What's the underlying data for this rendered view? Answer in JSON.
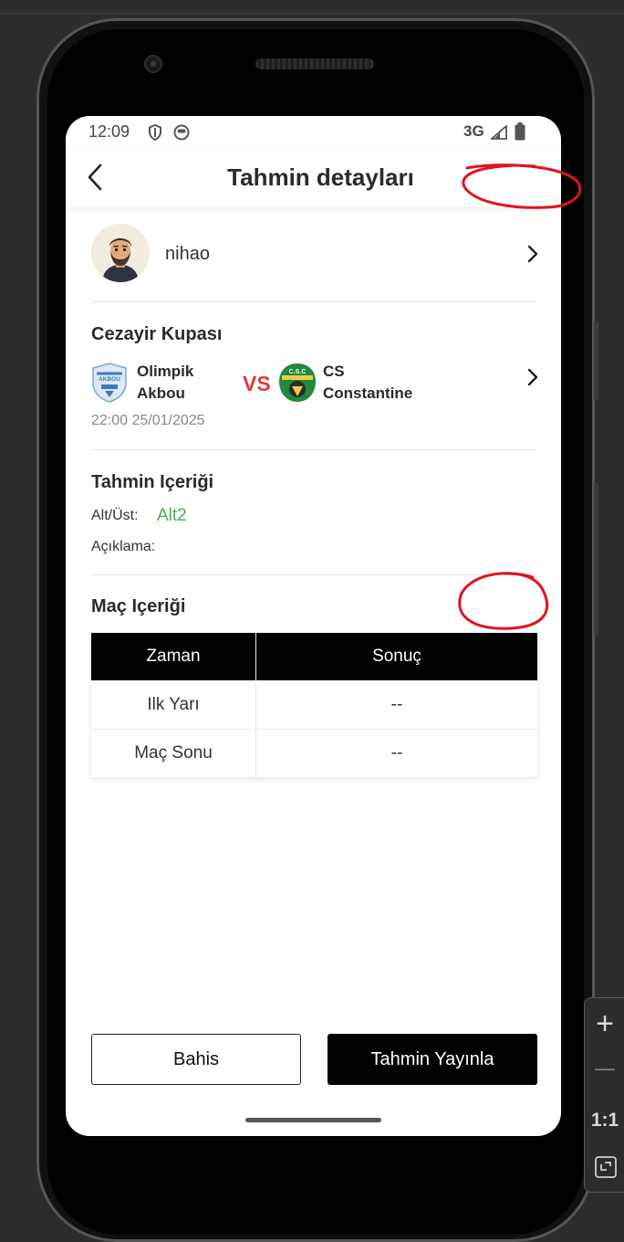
{
  "status_bar": {
    "time": "12:09",
    "network": "3G"
  },
  "header": {
    "title": "Tahmin detayları"
  },
  "user": {
    "name": "nihao"
  },
  "match": {
    "league": "Cezayir Kupası",
    "home_team": "Olimpik\nAkbou",
    "away_team": "CS\nConstantine",
    "home_logo_text": "AKBOU",
    "away_logo_text": "C.S.C",
    "vs": "VS",
    "datetime": "22:00 25/01/2025"
  },
  "prediction": {
    "section_title": "Tahmin Içeriği",
    "type_label": "Alt/Üst:",
    "type_value": "Alt2",
    "note_label": "Açıklama:"
  },
  "match_content": {
    "section_title": "Maç Içeriği",
    "columns": [
      "Zaman",
      "Sonuç"
    ],
    "rows": [
      {
        "time": "Ilk Yarı",
        "result": "--"
      },
      {
        "time": "Maç Sonu",
        "result": "--"
      }
    ]
  },
  "buttons": {
    "bet": "Bahis",
    "publish": "Tahmin Yayınla"
  },
  "zoom_panel": {
    "plus": "+",
    "minus": "—",
    "ratio": "1:1"
  },
  "colors": {
    "accent_green": "#4caf50",
    "vs_red": "#e03a3a",
    "annotation_red": "#e0141e"
  }
}
